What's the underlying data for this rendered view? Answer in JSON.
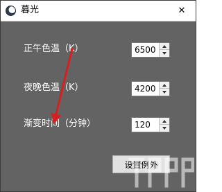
{
  "window": {
    "title": "暮光",
    "close_glyph": "✕"
  },
  "settings": [
    {
      "label": "正午色温（K）",
      "value": "6500"
    },
    {
      "label": "夜晚色温（K）",
      "value": "4200"
    },
    {
      "label": "渐变时间（分钟）",
      "value": "120"
    }
  ],
  "buttons": {
    "exceptions_label": "设置例外"
  },
  "annotation": {
    "arrow_color": "#d42020"
  },
  "icons": {
    "app": "moon-icon",
    "close": "close-icon",
    "spin_up": "chevron-up-icon",
    "spin_down": "chevron-down-icon"
  }
}
